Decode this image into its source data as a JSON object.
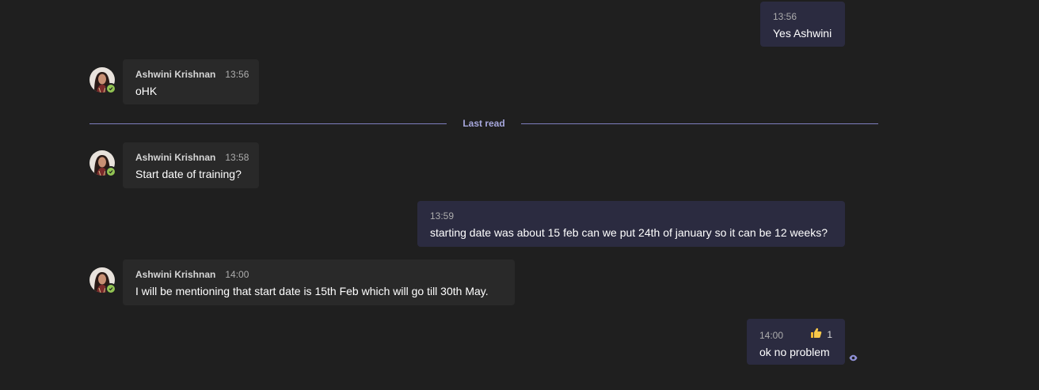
{
  "messages": [
    {
      "direction": "out",
      "time": "13:56",
      "text": "Yes Ashwini"
    },
    {
      "direction": "in",
      "sender": "Ashwini Krishnan",
      "time": "13:56",
      "text": "oHK"
    },
    {
      "direction": "in",
      "sender": "Ashwini Krishnan",
      "time": "13:58",
      "text": "Start date of training?"
    },
    {
      "direction": "out",
      "time": "13:59",
      "text": "starting date was about 15 feb can we put 24th of january so it can be 12 weeks?"
    },
    {
      "direction": "in",
      "sender": "Ashwini Krishnan",
      "time": "14:00",
      "text": "I will be mentioning that start date is 15th Feb which will go till 30th May."
    },
    {
      "direction": "out",
      "time": "14:00",
      "text": "ok no problem",
      "reaction": {
        "icon": "thumbs-up-icon",
        "count": "1"
      }
    }
  ],
  "divider": {
    "label": "Last read"
  },
  "colors": {
    "background": "#1f1f1f",
    "incoming_bubble": "#292929",
    "outgoing_bubble": "#2b2b40",
    "accent": "#a6a7dc",
    "presence_available": "#92c353"
  }
}
